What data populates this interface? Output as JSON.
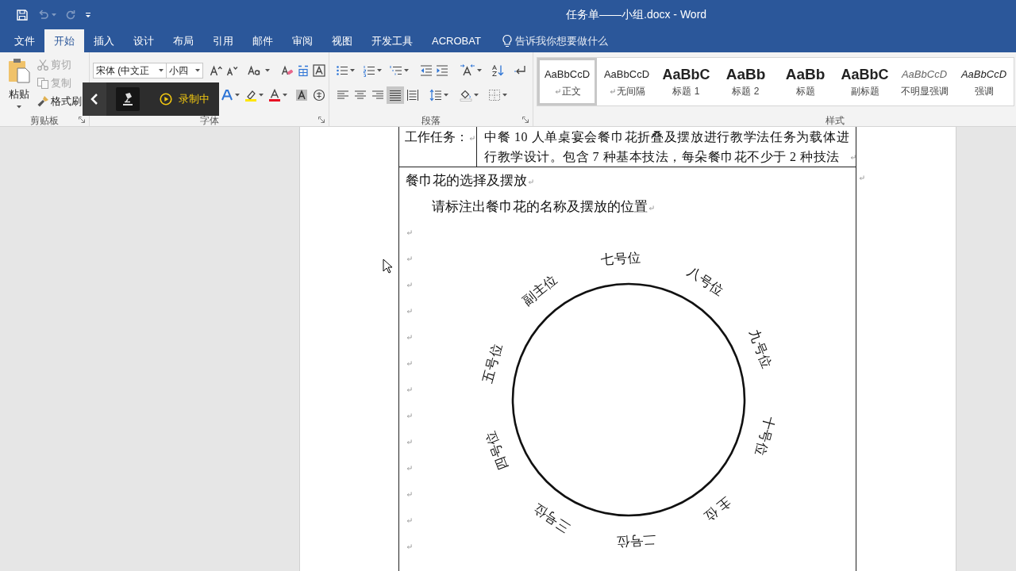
{
  "title_bar": {
    "quick_access": [
      {
        "kind": "save",
        "disabled": false
      },
      {
        "kind": "undo",
        "disabled": true
      },
      {
        "kind": "redo",
        "disabled": true
      },
      {
        "kind": "customize",
        "disabled": false
      }
    ],
    "title": "任务单——小组.docx - Word"
  },
  "tabs": [
    {
      "label": "文件",
      "selected": false
    },
    {
      "label": "开始",
      "selected": true
    },
    {
      "label": "插入",
      "selected": false
    },
    {
      "label": "设计",
      "selected": false
    },
    {
      "label": "布局",
      "selected": false
    },
    {
      "label": "引用",
      "selected": false
    },
    {
      "label": "邮件",
      "selected": false
    },
    {
      "label": "审阅",
      "selected": false
    },
    {
      "label": "视图",
      "selected": false
    },
    {
      "label": "开发工具",
      "selected": false
    },
    {
      "label": "ACROBAT",
      "selected": false
    }
  ],
  "tell_me": {
    "placeholder": "告诉我你想要做什么"
  },
  "ribbon": {
    "clipboard": {
      "label": "剪贴板",
      "paste": "粘贴",
      "items": [
        {
          "kind": "cut",
          "label": "剪切",
          "disabled": true
        },
        {
          "kind": "copy",
          "label": "复制",
          "disabled": true
        },
        {
          "kind": "format_painter",
          "label": "格式刷",
          "disabled": false
        }
      ]
    },
    "font": {
      "label": "字体",
      "font_name": {
        "value": "宋体 (中文正"
      },
      "font_size": {
        "value": "小四"
      }
    },
    "paragraph": {
      "label": "段落",
      "alignment": [
        {
          "kind": "left",
          "selected": false
        },
        {
          "kind": "center",
          "selected": false
        },
        {
          "kind": "right",
          "selected": false
        },
        {
          "kind": "justify",
          "selected": true
        },
        {
          "kind": "distributed",
          "selected": false
        }
      ]
    },
    "styles": {
      "label": "样式",
      "items": [
        {
          "kind": "normal",
          "preview": "AaBbCcD",
          "name": "正文",
          "paragraph_mark": true,
          "selected": true
        },
        {
          "kind": "no_spacing",
          "preview": "AaBbCcD",
          "name": "无间隔",
          "paragraph_mark": true,
          "selected": false
        },
        {
          "kind": "heading1",
          "preview": "AaBbC",
          "name": "标题 1",
          "paragraph_mark": false,
          "selected": false
        },
        {
          "kind": "heading2",
          "preview": "AaBb",
          "name": "标题 2",
          "paragraph_mark": false,
          "selected": false
        },
        {
          "kind": "title",
          "preview": "AaBb",
          "name": "标题",
          "paragraph_mark": false,
          "selected": false
        },
        {
          "kind": "subtitle",
          "preview": "AaBbC",
          "name": "副标题",
          "paragraph_mark": false,
          "selected": false
        },
        {
          "kind": "subtle_emphasis",
          "preview": "AaBbCcD",
          "name": "不明显强调",
          "paragraph_mark": false,
          "selected": false
        },
        {
          "kind": "emphasis",
          "preview": "AaBbCcD",
          "name": "强调",
          "paragraph_mark": false,
          "selected": false
        }
      ]
    }
  },
  "recorder": {
    "status": "录制中"
  },
  "document": {
    "task_row": {
      "label": "工作任务：",
      "text": "中餐 10 人单桌宴会餐巾花折叠及摆放进行教学法任务为载体进行教学设计。包含 7 种基本技法，每朵餐巾花不少于 2 种技法"
    },
    "section": {
      "heading": "餐巾花的选择及摆放",
      "instruction": "请标注出餐巾花的名称及摆放的位置",
      "seat_labels": [
        "七号位",
        "八号位",
        "九号位",
        "十号位",
        "主 位",
        "二号位",
        "三号位",
        "四号位",
        "五号位",
        "副主位"
      ]
    }
  }
}
